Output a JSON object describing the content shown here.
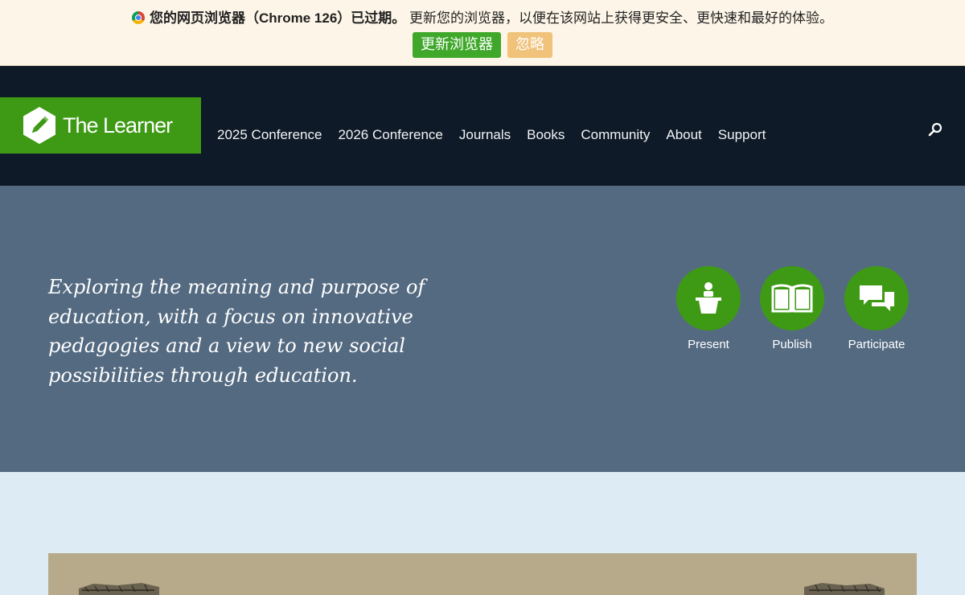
{
  "banner": {
    "browser_icon": "chrome-icon",
    "bold_text": "您的网页浏览器（Chrome 126）已过期。",
    "message": "更新您的浏览器，以便在该网站上获得更安全、更快速和最好的体验。",
    "update_label": "更新浏览器",
    "ignore_label": "忽略"
  },
  "nav": {
    "logo_text": "The Learner",
    "logo_icon": "pencil-hexagon-icon",
    "items": [
      {
        "label": "2025 Conference"
      },
      {
        "label": "2026 Conference"
      },
      {
        "label": "Journals"
      },
      {
        "label": "Books"
      },
      {
        "label": "Community"
      },
      {
        "label": "About"
      },
      {
        "label": "Support"
      }
    ],
    "search_icon": "search-icon"
  },
  "hero": {
    "tagline": "Exploring the meaning and purpose of education, with a focus on innovative pedagogies and a view to new social possibilities through education.",
    "actions": [
      {
        "label": "Present",
        "icon": "podium-icon"
      },
      {
        "label": "Publish",
        "icon": "open-book-icon"
      },
      {
        "label": "Participate",
        "icon": "chat-bubbles-icon"
      }
    ]
  },
  "colors": {
    "brand_green": "#3e9a15",
    "nav_bg": "#0e1a27",
    "hero_bg": "#546a81",
    "banner_bg": "#fdf6e8",
    "page_bg": "#ddecf4",
    "ignore_button": "#f0c27a"
  }
}
